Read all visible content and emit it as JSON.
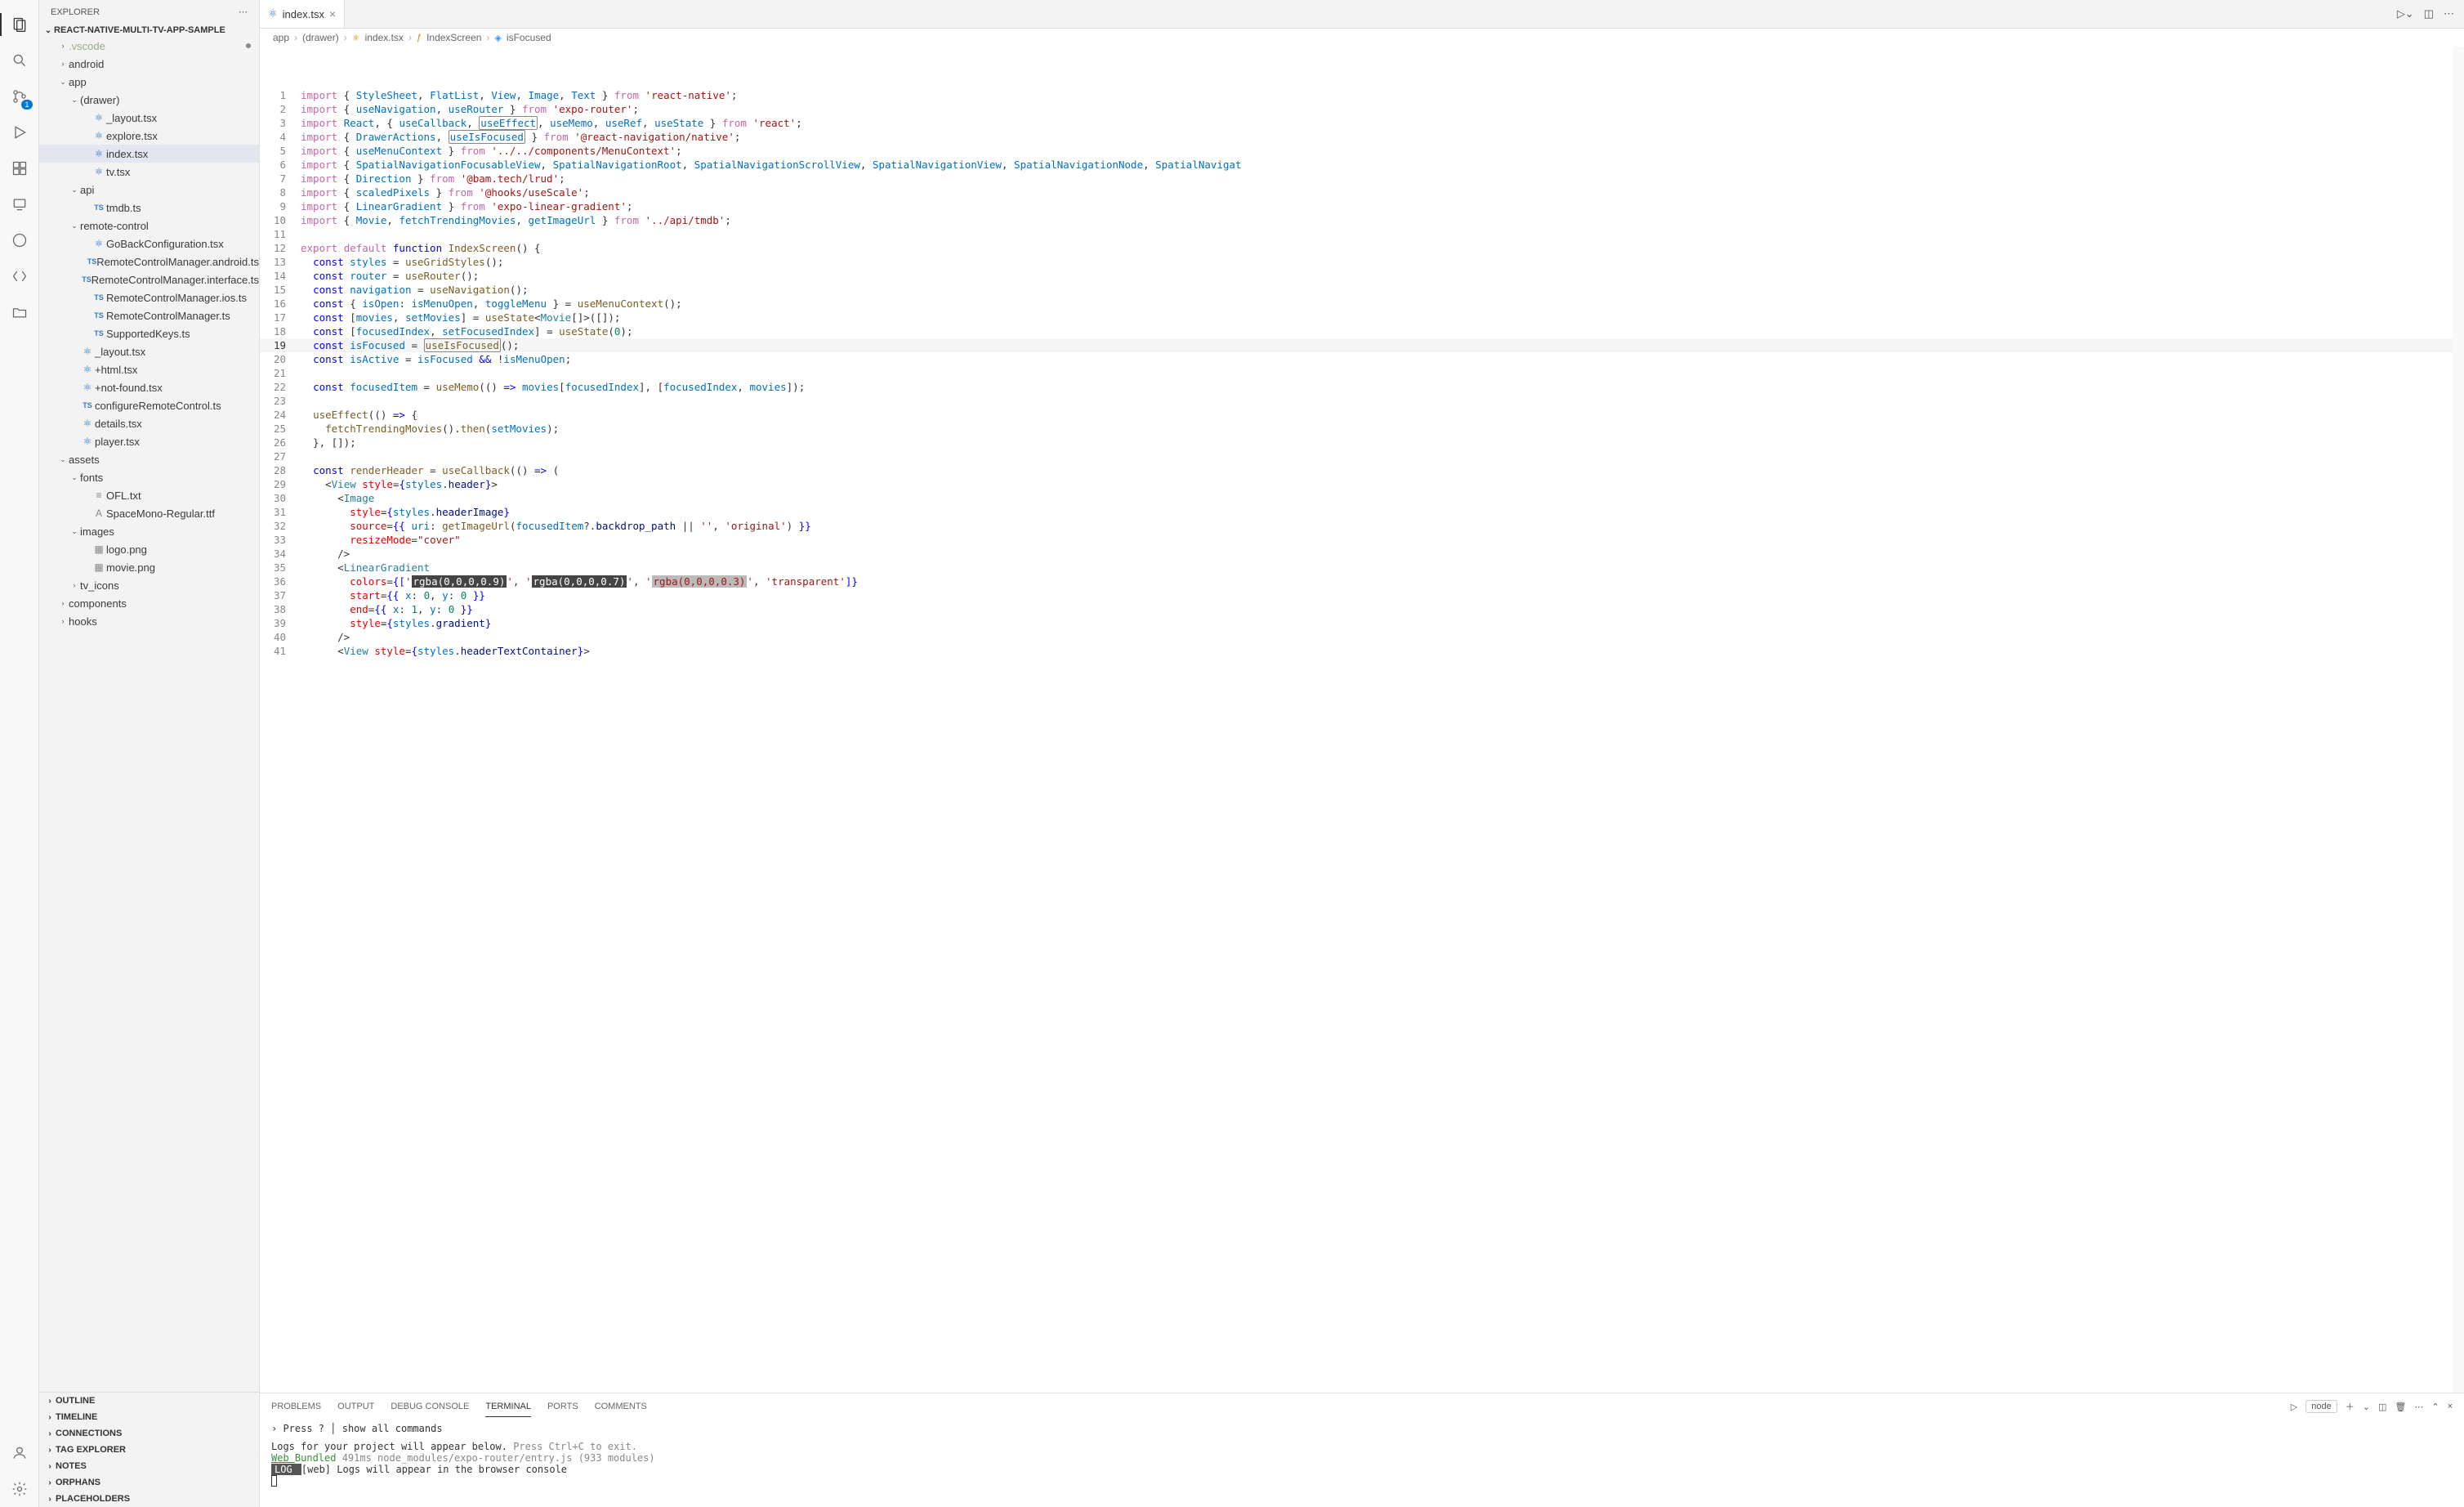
{
  "sidebar": {
    "title": "EXPLORER",
    "project": "REACT-NATIVE-MULTI-TV-APP-SAMPLE",
    "tree": [
      {
        "name": ".vscode",
        "depth": 1,
        "chev": "right",
        "dimmed": true,
        "modified": true
      },
      {
        "name": "android",
        "depth": 1,
        "chev": "right"
      },
      {
        "name": "app",
        "depth": 1,
        "chev": "down"
      },
      {
        "name": "(drawer)",
        "depth": 2,
        "chev": "down"
      },
      {
        "name": "_layout.tsx",
        "depth": 3,
        "icon": "ts"
      },
      {
        "name": "explore.tsx",
        "depth": 3,
        "icon": "ts"
      },
      {
        "name": "index.tsx",
        "depth": 3,
        "icon": "ts",
        "selected": true
      },
      {
        "name": "tv.tsx",
        "depth": 3,
        "icon": "ts"
      },
      {
        "name": "api",
        "depth": 2,
        "chev": "down"
      },
      {
        "name": "tmdb.ts",
        "depth": 3,
        "icon": "TS"
      },
      {
        "name": "remote-control",
        "depth": 2,
        "chev": "down"
      },
      {
        "name": "GoBackConfiguration.tsx",
        "depth": 3,
        "icon": "ts"
      },
      {
        "name": "RemoteControlManager.android.ts",
        "depth": 3,
        "icon": "TS"
      },
      {
        "name": "RemoteControlManager.interface.ts",
        "depth": 3,
        "icon": "TS"
      },
      {
        "name": "RemoteControlManager.ios.ts",
        "depth": 3,
        "icon": "TS"
      },
      {
        "name": "RemoteControlManager.ts",
        "depth": 3,
        "icon": "TS"
      },
      {
        "name": "SupportedKeys.ts",
        "depth": 3,
        "icon": "TS"
      },
      {
        "name": "_layout.tsx",
        "depth": 2,
        "icon": "ts"
      },
      {
        "name": "+html.tsx",
        "depth": 2,
        "icon": "ts"
      },
      {
        "name": "+not-found.tsx",
        "depth": 2,
        "icon": "ts"
      },
      {
        "name": "configureRemoteControl.ts",
        "depth": 2,
        "icon": "TS"
      },
      {
        "name": "details.tsx",
        "depth": 2,
        "icon": "ts"
      },
      {
        "name": "player.tsx",
        "depth": 2,
        "icon": "ts"
      },
      {
        "name": "assets",
        "depth": 1,
        "chev": "down"
      },
      {
        "name": "fonts",
        "depth": 2,
        "chev": "down"
      },
      {
        "name": "OFL.txt",
        "depth": 3,
        "icon": "txt"
      },
      {
        "name": "SpaceMono-Regular.ttf",
        "depth": 3,
        "icon": "f"
      },
      {
        "name": "images",
        "depth": 2,
        "chev": "down"
      },
      {
        "name": "logo.png",
        "depth": 3,
        "icon": "img"
      },
      {
        "name": "movie.png",
        "depth": 3,
        "icon": "img"
      },
      {
        "name": "tv_icons",
        "depth": 2,
        "chev": "right"
      },
      {
        "name": "components",
        "depth": 1,
        "chev": "right"
      },
      {
        "name": "hooks",
        "depth": 1,
        "chev": "right",
        "cut": true
      }
    ],
    "collapsed": [
      "OUTLINE",
      "TIMELINE",
      "CONNECTIONS",
      "TAG EXPLORER",
      "NOTES",
      "ORPHANS",
      "PLACEHOLDERS"
    ]
  },
  "tabs": {
    "active": {
      "icon": "ts",
      "label": "index.tsx"
    }
  },
  "breadcrumb": [
    "app",
    "(drawer)",
    "index.tsx",
    "IndexScreen",
    "isFocused"
  ],
  "code": [
    {
      "n": 1,
      "html": "<span class='k-import'>import</span> { <span class='k-var'>StyleSheet</span>, <span class='k-var'>FlatList</span>, <span class='k-var'>View</span>, <span class='k-var'>Image</span>, <span class='k-var'>Text</span> } <span class='k-import'>from</span> <span class='k-str'>'react-native'</span>;"
    },
    {
      "n": 2,
      "html": "<span class='k-import'>import</span> { <span class='k-var'>useNavigation</span>, <span class='k-var'>useRouter</span> } <span class='k-import'>from</span> <span class='k-str'>'expo-router'</span>;"
    },
    {
      "n": 3,
      "html": "<span class='k-import'>import</span> <span class='k-var'>React</span>, { <span class='k-var'>useCallback</span>, <span class='k-var hl-box'>useEffect</span>, <span class='k-var'>useMemo</span>, <span class='k-var'>useRef</span>, <span class='k-var'>useState</span> } <span class='k-import'>from</span> <span class='k-str'>'react'</span>;"
    },
    {
      "n": 4,
      "html": "<span class='k-import'>import</span> { <span class='k-var'>DrawerActions</span>, <span class='k-var hl-box'>useIsFocused</span> } <span class='k-import'>from</span> <span class='k-str'>'@react-navigation/native'</span>;"
    },
    {
      "n": 5,
      "html": "<span class='k-import'>import</span> { <span class='k-var'>useMenuContext</span> } <span class='k-import'>from</span> <span class='k-str'>'../../components/MenuContext'</span>;"
    },
    {
      "n": 6,
      "html": "<span class='k-import'>import</span> { <span class='k-var'>SpatialNavigationFocusableView</span>, <span class='k-var'>SpatialNavigationRoot</span>, <span class='k-var'>SpatialNavigationScrollView</span>, <span class='k-var'>SpatialNavigationView</span>, <span class='k-var'>SpatialNavigationNode</span>, <span class='k-var'>SpatialNavigat</span>"
    },
    {
      "n": 7,
      "html": "<span class='k-import'>import</span> { <span class='k-var'>Direction</span> } <span class='k-import'>from</span> <span class='k-str'>'@bam.tech/lrud'</span>;"
    },
    {
      "n": 8,
      "html": "<span class='k-import'>import</span> { <span class='k-var'>scaledPixels</span> } <span class='k-import'>from</span> <span class='k-str'>'@hooks/useScale'</span>;"
    },
    {
      "n": 9,
      "html": "<span class='k-import'>import</span> { <span class='k-var'>LinearGradient</span> } <span class='k-import'>from</span> <span class='k-str'>'expo-linear-gradient'</span>;"
    },
    {
      "n": 10,
      "html": "<span class='k-import'>import</span> { <span class='k-var'>Movie</span>, <span class='k-var'>fetchTrendingMovies</span>, <span class='k-var'>getImageUrl</span> } <span class='k-import'>from</span> <span class='k-str'>'../api/tmdb'</span>;"
    },
    {
      "n": 11,
      "html": ""
    },
    {
      "n": 12,
      "html": "<span class='k-import'>export</span> <span class='k-import'>default</span> <span class='k-kw'>function</span> <span class='k-fn'>IndexScreen</span>() <span class='k-op'>{</span>"
    },
    {
      "n": 13,
      "html": "  <span class='k-kw'>const</span> <span class='k-var'>styles</span> = <span class='k-fn'>useGridStyles</span>();"
    },
    {
      "n": 14,
      "html": "  <span class='k-kw'>const</span> <span class='k-var'>router</span> = <span class='k-fn'>useRouter</span>();"
    },
    {
      "n": 15,
      "html": "  <span class='k-kw'>const</span> <span class='k-var'>navigation</span> = <span class='k-fn'>useNavigation</span>();"
    },
    {
      "n": 16,
      "html": "  <span class='k-kw'>const</span> { <span class='k-var'>isOpen</span>: <span class='k-var'>isMenuOpen</span>, <span class='k-var'>toggleMenu</span> } = <span class='k-fn'>useMenuContext</span>();"
    },
    {
      "n": 17,
      "html": "  <span class='k-kw'>const</span> [<span class='k-var'>movies</span>, <span class='k-var'>setMovies</span>] = <span class='k-fn'>useState</span>&lt;<span class='k-type'>Movie</span>[]&gt;([]);"
    },
    {
      "n": 18,
      "html": "  <span class='k-kw'>const</span> [<span class='k-var'>focusedIndex</span>, <span class='k-var'>setFocusedIndex</span>] = <span class='k-fn'>useState</span>(<span class='k-num'>0</span>);"
    },
    {
      "n": 19,
      "html": "  <span class='k-kw'>const</span> <span class='k-var'>isFocused</span> = <span class='k-fn hl-box'>useIsFocused</span>();",
      "current": true
    },
    {
      "n": 20,
      "html": "  <span class='k-kw'>const</span> <span class='k-var'>isActive</span> = <span class='k-var'>isFocused</span> <span class='k-kw'>&amp;&amp;</span> !<span class='k-var'>isMenuOpen</span>;"
    },
    {
      "n": 21,
      "html": ""
    },
    {
      "n": 22,
      "html": "  <span class='k-kw'>const</span> <span class='k-var'>focusedItem</span> = <span class='k-fn'>useMemo</span>(() <span class='k-kw'>=&gt;</span> <span class='k-var'>movies</span>[<span class='k-var'>focusedIndex</span>], [<span class='k-var'>focusedIndex</span>, <span class='k-var'>movies</span>]);"
    },
    {
      "n": 23,
      "html": ""
    },
    {
      "n": 24,
      "html": "  <span class='k-fn'>useEffect</span>(() <span class='k-kw'>=&gt;</span> {"
    },
    {
      "n": 25,
      "html": "    <span class='k-fn'>fetchTrendingMovies</span>().<span class='k-fn'>then</span>(<span class='k-var'>setMovies</span>);"
    },
    {
      "n": 26,
      "html": "  }, []);"
    },
    {
      "n": 27,
      "html": ""
    },
    {
      "n": 28,
      "html": "  <span class='k-kw'>const</span> <span class='k-fn'>renderHeader</span> = <span class='k-fn'>useCallback</span>(() <span class='k-kw'>=&gt;</span> ("
    },
    {
      "n": 29,
      "html": "    &lt;<span class='k-tag'>View</span> <span class='k-attr'>style</span>=<span class='k-kw'>{</span><span class='k-var'>styles</span>.<span class='k-prop'>header</span><span class='k-kw'>}</span>&gt;"
    },
    {
      "n": 30,
      "html": "      &lt;<span class='k-tag'>Image</span>"
    },
    {
      "n": 31,
      "html": "        <span class='k-attr'>style</span>=<span class='k-kw'>{</span><span class='k-var'>styles</span>.<span class='k-prop'>headerImage</span><span class='k-kw'>}</span>"
    },
    {
      "n": 32,
      "html": "        <span class='k-attr'>source</span>=<span class='k-kw'>{{</span> <span class='k-var'>uri</span>: <span class='k-fn'>getImageUrl</span>(<span class='k-var'>focusedItem</span>?.<span class='k-prop'>backdrop_path</span> || <span class='k-str'>''</span>, <span class='k-str'>'original'</span>) <span class='k-kw'>}}</span>"
    },
    {
      "n": 33,
      "html": "        <span class='k-attr'>resizeMode</span>=<span class='k-str'>\"cover\"</span>"
    },
    {
      "n": 34,
      "html": "      /&gt;"
    },
    {
      "n": 35,
      "html": "      &lt;<span class='k-tag'>LinearGradient</span>"
    },
    {
      "n": 36,
      "html": "        <span class='k-attr'>colors</span>=<span class='k-kw'>{[</span><span class='k-str'>'<span class='hl-dark'>rgba(0,0,0,0.9)</span>'</span>, <span class='k-str'>'<span class='hl-dark'>rgba(0,0,0,0.7)</span>'</span>, <span class='k-str'>'<span class='hl-gray'>rgba(0,0,0,0.3)</span>'</span>, <span class='k-str'>'transparent'</span><span class='k-kw'>]}</span>"
    },
    {
      "n": 37,
      "html": "        <span class='k-attr'>start</span>=<span class='k-kw'>{{</span> <span class='k-var'>x</span>: <span class='k-num'>0</span>, <span class='k-var'>y</span>: <span class='k-num'>0</span> <span class='k-kw'>}}</span>"
    },
    {
      "n": 38,
      "html": "        <span class='k-attr'>end</span>=<span class='k-kw'>{{</span> <span class='k-var'>x</span>: <span class='k-num'>1</span>, <span class='k-var'>y</span>: <span class='k-num'>0</span> <span class='k-kw'>}}</span>"
    },
    {
      "n": 39,
      "html": "        <span class='k-attr'>style</span>=<span class='k-kw'>{</span><span class='k-var'>styles</span>.<span class='k-prop'>gradient</span><span class='k-kw'>}</span>"
    },
    {
      "n": 40,
      "html": "      /&gt;"
    },
    {
      "n": 41,
      "html": "      &lt;<span class='k-tag'>View</span> <span class='k-attr'>style</span>=<span class='k-kw'>{</span><span class='k-var'>styles</span>.<span class='k-prop'>headerTextContainer</span><span class='k-kw'>}</span>&gt;"
    }
  ],
  "panel": {
    "tabs": [
      "PROBLEMS",
      "OUTPUT",
      "DEBUG CONSOLE",
      "TERMINAL",
      "PORTS",
      "COMMENTS"
    ],
    "active": "TERMINAL",
    "node_label": "node",
    "hint_prefix": "› Press ",
    "hint_key": "?",
    "hint_sep": " │ ",
    "hint_text": "show all commands",
    "line1": "Logs for your project will appear below.",
    "line1b": " Press Ctrl+C to exit.",
    "line2a": "Web ",
    "line2b": "Bundled",
    "line2c": " 491ms node_modules/expo-router/entry.js (933 modules)",
    "log_label": " LOG ",
    "log_text": " [web] Logs will appear in the browser console"
  },
  "activity_badge": "1"
}
